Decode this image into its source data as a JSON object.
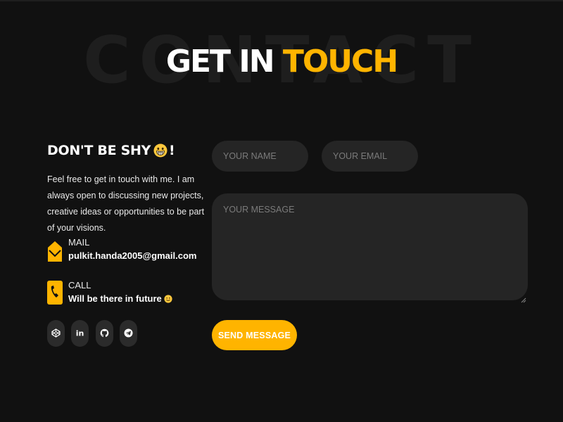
{
  "heading": {
    "background_word": "CONTACT",
    "title_part1": "GET IN",
    "title_part2": "TOUCH"
  },
  "intro": {
    "title": "DON'T BE SHY",
    "title_emoji": "grinning-face-icon",
    "title_suffix": "!",
    "text": "Feel free to get in touch with me. I am always open to discussing new projects, creative ideas or opportunities to be part of your visions."
  },
  "contact": {
    "mail": {
      "label": "MAIL",
      "value": "pulkit.handa2005@gmail.com",
      "icon": "envelope-open-icon"
    },
    "call": {
      "label": "CALL",
      "value": "Will be there in future",
      "emoji": "smiling-face-icon",
      "icon": "phone-icon"
    }
  },
  "socials": [
    {
      "name": "codepen",
      "icon": "codepen-icon"
    },
    {
      "name": "linkedin",
      "icon": "linkedin-icon",
      "text": "in"
    },
    {
      "name": "github",
      "icon": "github-icon"
    },
    {
      "name": "telegram",
      "icon": "telegram-icon"
    }
  ],
  "form": {
    "name_placeholder": "YOUR NAME",
    "email_placeholder": "YOUR EMAIL",
    "message_placeholder": "YOUR MESSAGE",
    "send_label": "SEND MESSAGE"
  },
  "colors": {
    "background": "#111111",
    "accent": "#ffb400",
    "field": "#252525",
    "social_bg": "#2b2b2b"
  }
}
